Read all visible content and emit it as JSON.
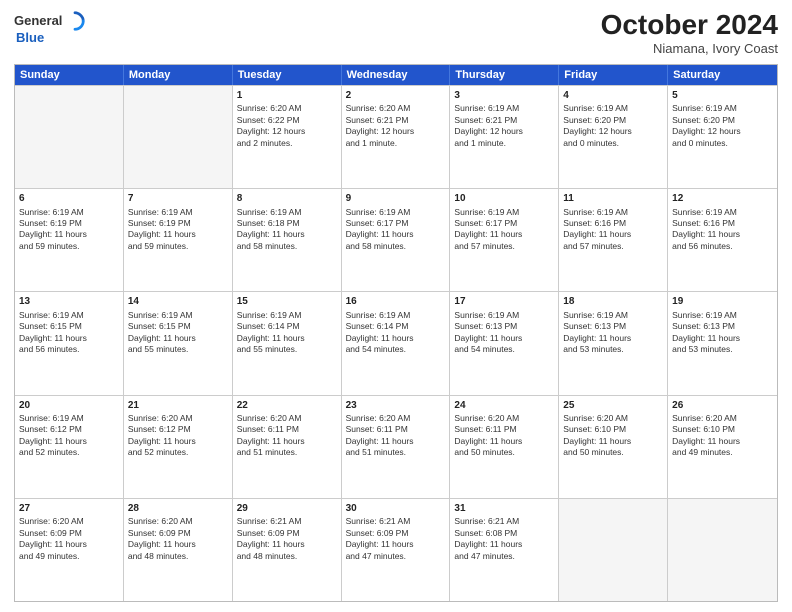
{
  "logo": {
    "general": "General",
    "blue": "Blue"
  },
  "title": "October 2024",
  "subtitle": "Niamana, Ivory Coast",
  "headers": [
    "Sunday",
    "Monday",
    "Tuesday",
    "Wednesday",
    "Thursday",
    "Friday",
    "Saturday"
  ],
  "rows": [
    [
      {
        "day": "",
        "lines": [],
        "empty": true
      },
      {
        "day": "",
        "lines": [],
        "empty": true
      },
      {
        "day": "1",
        "lines": [
          "Sunrise: 6:20 AM",
          "Sunset: 6:22 PM",
          "Daylight: 12 hours",
          "and 2 minutes."
        ]
      },
      {
        "day": "2",
        "lines": [
          "Sunrise: 6:20 AM",
          "Sunset: 6:21 PM",
          "Daylight: 12 hours",
          "and 1 minute."
        ]
      },
      {
        "day": "3",
        "lines": [
          "Sunrise: 6:19 AM",
          "Sunset: 6:21 PM",
          "Daylight: 12 hours",
          "and 1 minute."
        ]
      },
      {
        "day": "4",
        "lines": [
          "Sunrise: 6:19 AM",
          "Sunset: 6:20 PM",
          "Daylight: 12 hours",
          "and 0 minutes."
        ]
      },
      {
        "day": "5",
        "lines": [
          "Sunrise: 6:19 AM",
          "Sunset: 6:20 PM",
          "Daylight: 12 hours",
          "and 0 minutes."
        ]
      }
    ],
    [
      {
        "day": "6",
        "lines": [
          "Sunrise: 6:19 AM",
          "Sunset: 6:19 PM",
          "Daylight: 11 hours",
          "and 59 minutes."
        ]
      },
      {
        "day": "7",
        "lines": [
          "Sunrise: 6:19 AM",
          "Sunset: 6:19 PM",
          "Daylight: 11 hours",
          "and 59 minutes."
        ]
      },
      {
        "day": "8",
        "lines": [
          "Sunrise: 6:19 AM",
          "Sunset: 6:18 PM",
          "Daylight: 11 hours",
          "and 58 minutes."
        ]
      },
      {
        "day": "9",
        "lines": [
          "Sunrise: 6:19 AM",
          "Sunset: 6:17 PM",
          "Daylight: 11 hours",
          "and 58 minutes."
        ]
      },
      {
        "day": "10",
        "lines": [
          "Sunrise: 6:19 AM",
          "Sunset: 6:17 PM",
          "Daylight: 11 hours",
          "and 57 minutes."
        ]
      },
      {
        "day": "11",
        "lines": [
          "Sunrise: 6:19 AM",
          "Sunset: 6:16 PM",
          "Daylight: 11 hours",
          "and 57 minutes."
        ]
      },
      {
        "day": "12",
        "lines": [
          "Sunrise: 6:19 AM",
          "Sunset: 6:16 PM",
          "Daylight: 11 hours",
          "and 56 minutes."
        ]
      }
    ],
    [
      {
        "day": "13",
        "lines": [
          "Sunrise: 6:19 AM",
          "Sunset: 6:15 PM",
          "Daylight: 11 hours",
          "and 56 minutes."
        ]
      },
      {
        "day": "14",
        "lines": [
          "Sunrise: 6:19 AM",
          "Sunset: 6:15 PM",
          "Daylight: 11 hours",
          "and 55 minutes."
        ]
      },
      {
        "day": "15",
        "lines": [
          "Sunrise: 6:19 AM",
          "Sunset: 6:14 PM",
          "Daylight: 11 hours",
          "and 55 minutes."
        ]
      },
      {
        "day": "16",
        "lines": [
          "Sunrise: 6:19 AM",
          "Sunset: 6:14 PM",
          "Daylight: 11 hours",
          "and 54 minutes."
        ]
      },
      {
        "day": "17",
        "lines": [
          "Sunrise: 6:19 AM",
          "Sunset: 6:13 PM",
          "Daylight: 11 hours",
          "and 54 minutes."
        ]
      },
      {
        "day": "18",
        "lines": [
          "Sunrise: 6:19 AM",
          "Sunset: 6:13 PM",
          "Daylight: 11 hours",
          "and 53 minutes."
        ]
      },
      {
        "day": "19",
        "lines": [
          "Sunrise: 6:19 AM",
          "Sunset: 6:13 PM",
          "Daylight: 11 hours",
          "and 53 minutes."
        ]
      }
    ],
    [
      {
        "day": "20",
        "lines": [
          "Sunrise: 6:19 AM",
          "Sunset: 6:12 PM",
          "Daylight: 11 hours",
          "and 52 minutes."
        ]
      },
      {
        "day": "21",
        "lines": [
          "Sunrise: 6:20 AM",
          "Sunset: 6:12 PM",
          "Daylight: 11 hours",
          "and 52 minutes."
        ]
      },
      {
        "day": "22",
        "lines": [
          "Sunrise: 6:20 AM",
          "Sunset: 6:11 PM",
          "Daylight: 11 hours",
          "and 51 minutes."
        ]
      },
      {
        "day": "23",
        "lines": [
          "Sunrise: 6:20 AM",
          "Sunset: 6:11 PM",
          "Daylight: 11 hours",
          "and 51 minutes."
        ]
      },
      {
        "day": "24",
        "lines": [
          "Sunrise: 6:20 AM",
          "Sunset: 6:11 PM",
          "Daylight: 11 hours",
          "and 50 minutes."
        ]
      },
      {
        "day": "25",
        "lines": [
          "Sunrise: 6:20 AM",
          "Sunset: 6:10 PM",
          "Daylight: 11 hours",
          "and 50 minutes."
        ]
      },
      {
        "day": "26",
        "lines": [
          "Sunrise: 6:20 AM",
          "Sunset: 6:10 PM",
          "Daylight: 11 hours",
          "and 49 minutes."
        ]
      }
    ],
    [
      {
        "day": "27",
        "lines": [
          "Sunrise: 6:20 AM",
          "Sunset: 6:09 PM",
          "Daylight: 11 hours",
          "and 49 minutes."
        ]
      },
      {
        "day": "28",
        "lines": [
          "Sunrise: 6:20 AM",
          "Sunset: 6:09 PM",
          "Daylight: 11 hours",
          "and 48 minutes."
        ]
      },
      {
        "day": "29",
        "lines": [
          "Sunrise: 6:21 AM",
          "Sunset: 6:09 PM",
          "Daylight: 11 hours",
          "and 48 minutes."
        ]
      },
      {
        "day": "30",
        "lines": [
          "Sunrise: 6:21 AM",
          "Sunset: 6:09 PM",
          "Daylight: 11 hours",
          "and 47 minutes."
        ]
      },
      {
        "day": "31",
        "lines": [
          "Sunrise: 6:21 AM",
          "Sunset: 6:08 PM",
          "Daylight: 11 hours",
          "and 47 minutes."
        ]
      },
      {
        "day": "",
        "lines": [],
        "empty": true
      },
      {
        "day": "",
        "lines": [],
        "empty": true
      }
    ]
  ]
}
